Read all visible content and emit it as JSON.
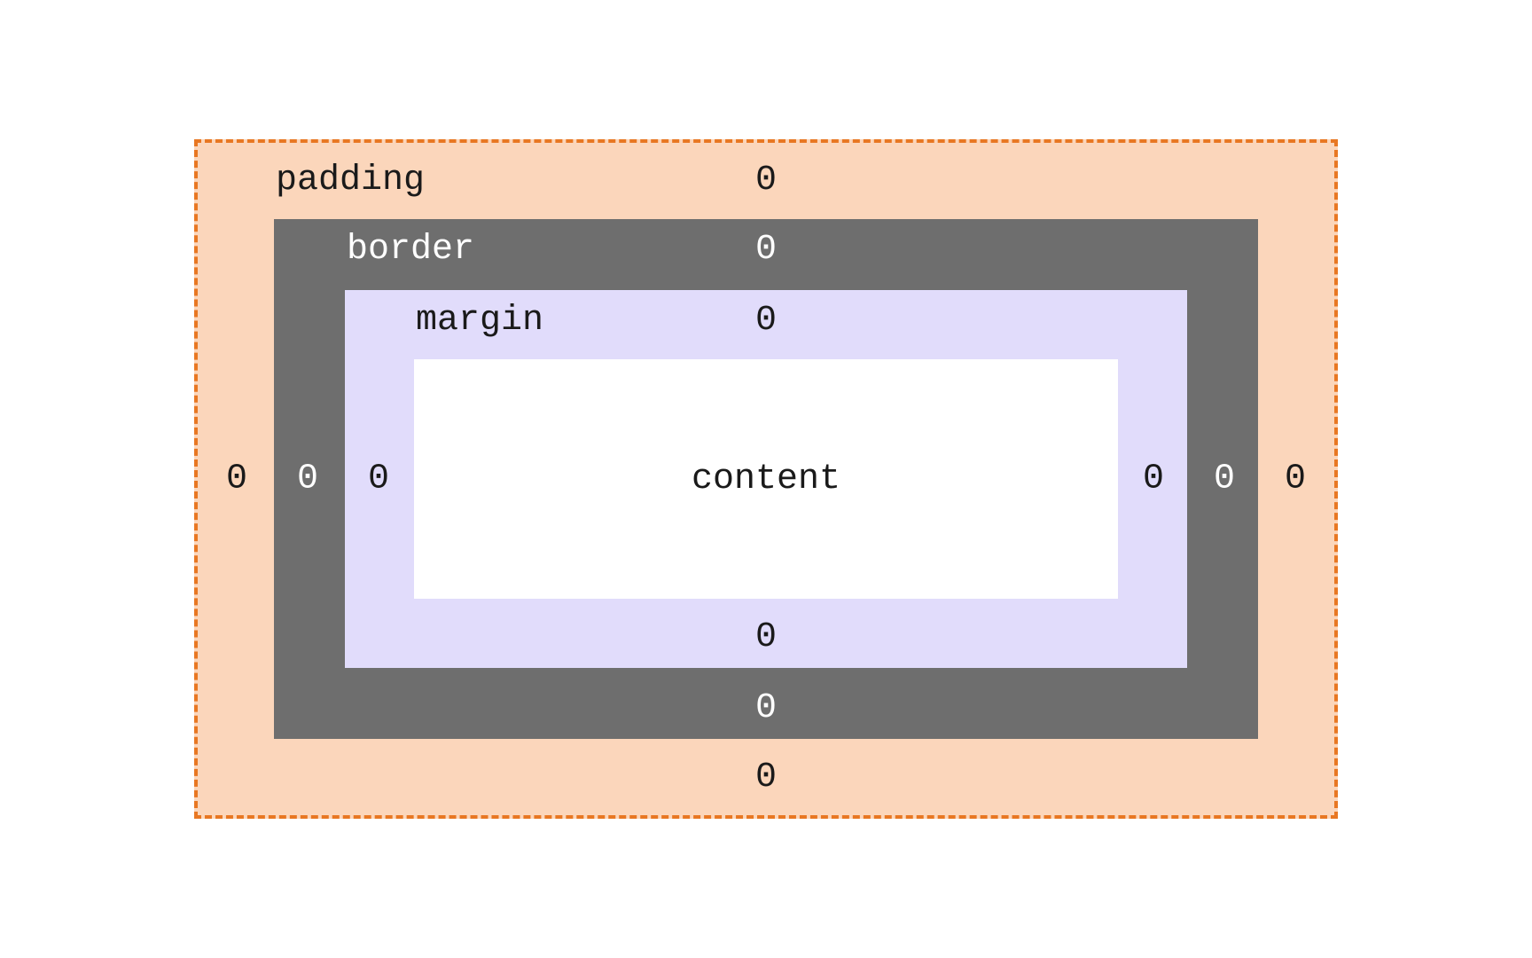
{
  "box_model": {
    "padding": {
      "label": "padding",
      "top": "0",
      "right": "0",
      "bottom": "0",
      "left": "0"
    },
    "border": {
      "label": "border",
      "top": "0",
      "right": "0",
      "bottom": "0",
      "left": "0"
    },
    "margin": {
      "label": "margin",
      "top": "0",
      "right": "0",
      "bottom": "0",
      "left": "0"
    },
    "content": {
      "label": "content"
    }
  },
  "colors": {
    "padding_bg": "#fbd6bb",
    "padding_border": "#e87722",
    "border_bg": "#6e6e6e",
    "margin_bg": "#e1dcfb",
    "content_bg": "#ffffff"
  }
}
